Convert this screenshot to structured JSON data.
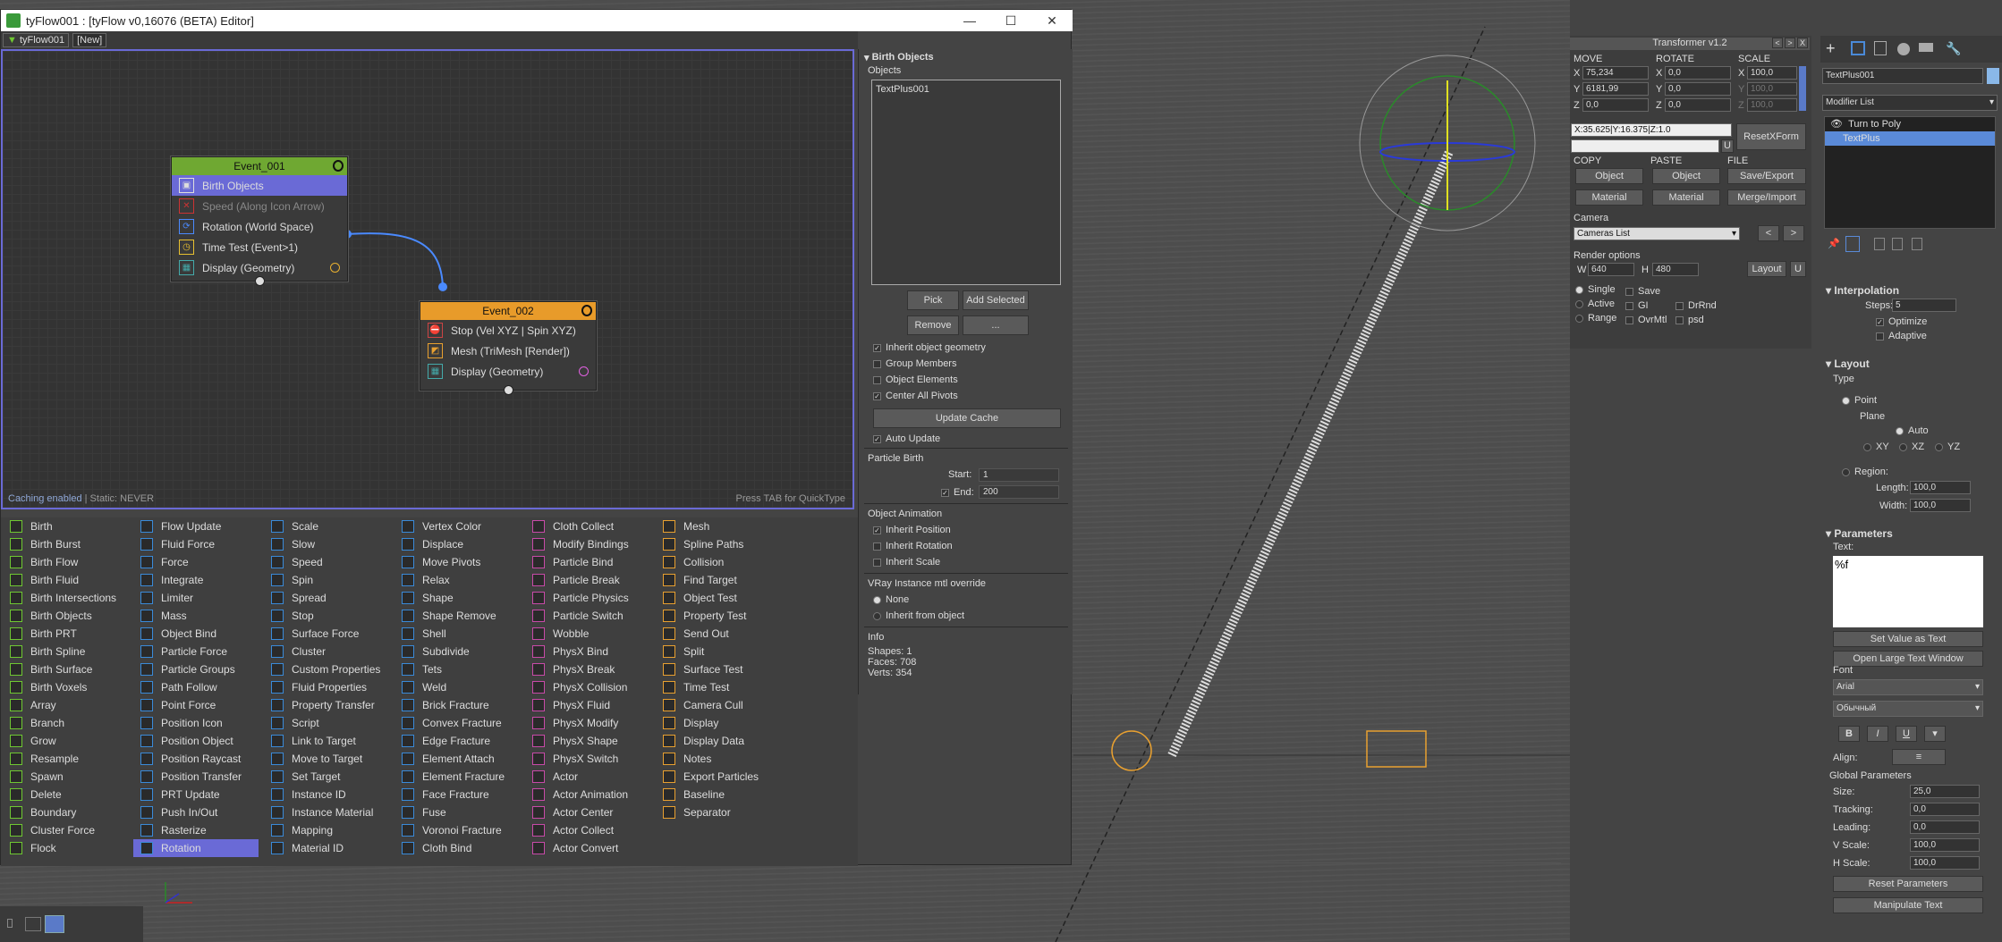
{
  "window": {
    "title": "tyFlow001 : [tyFlow v0,16076 (BETA) Editor]",
    "min": "—",
    "max": "☐",
    "close": "✕"
  },
  "tabs": [
    "tyFlow001",
    "[New]"
  ],
  "graph": {
    "status_enabled": "Caching enabled",
    "status_static": " | Static: NEVER",
    "hint": "Press TAB for QuickType",
    "event1": {
      "name": "Event_001",
      "color": "#6fa832",
      "ops": [
        "Birth Objects",
        "Speed (Along Icon Arrow)",
        "Rotation (World Space)",
        "Time Test (Event>1)",
        "Display (Geometry)"
      ]
    },
    "event2": {
      "name": "Event_002",
      "color": "#e89b2a",
      "ops": [
        "Stop (Vel XYZ | Spin XYZ)",
        "Mesh (TriMesh [Render])",
        "Display (Geometry)"
      ]
    }
  },
  "right_panel": {
    "title": "Birth Objects",
    "objects_label": "Objects",
    "object_item": "TextPlus001",
    "pick": "Pick",
    "add_selected": "Add Selected",
    "remove": "Remove",
    "more": "...",
    "inherit_geom": "Inherit object geometry",
    "group_members": "Group Members",
    "object_elements": "Object Elements",
    "center_pivots": "Center All Pivots",
    "update_cache": "Update Cache",
    "auto_update": "Auto Update",
    "particle_birth": "Particle Birth",
    "start_label": "Start:",
    "start_val": "1",
    "end_label": "End:",
    "end_val": "200",
    "object_animation": "Object Animation",
    "inherit_position": "Inherit Position",
    "inherit_rotation": "Inherit Rotation",
    "inherit_scale": "Inherit Scale",
    "vray_label": "VRay Instance mtl override",
    "vray_none": "None",
    "vray_inherit": "Inherit from object",
    "info_label": "Info",
    "shapes": "Shapes: 1",
    "faces": "Faces: 708",
    "verts": "Verts: 354"
  },
  "operators": [
    [
      "Birth",
      "Birth Burst",
      "Birth Flow",
      "Birth Fluid",
      "Birth Intersections",
      "Birth Objects",
      "Birth PRT",
      "Birth Spline",
      "Birth Surface",
      "Birth Voxels",
      "Array",
      "Branch",
      "Grow",
      "Resample",
      "Spawn",
      "Delete",
      "Boundary",
      "Cluster Force",
      "Flock"
    ],
    [
      "Flow Update",
      "Fluid Force",
      "Force",
      "Integrate",
      "Limiter",
      "Mass",
      "Object Bind",
      "Particle Force",
      "Particle Groups",
      "Path Follow",
      "Point Force",
      "Position Icon",
      "Position Object",
      "Position Raycast",
      "Position Transfer",
      "PRT Update",
      "Push In/Out",
      "Rasterize",
      "Rotation"
    ],
    [
      "Scale",
      "Slow",
      "Speed",
      "Spin",
      "Spread",
      "Stop",
      "Surface Force",
      "Cluster",
      "Custom Properties",
      "Fluid Properties",
      "Property Transfer",
      "Script",
      "Link to Target",
      "Move to Target",
      "Set Target",
      "Instance ID",
      "Instance Material",
      "Mapping",
      "Material ID"
    ],
    [
      "Vertex Color",
      "Displace",
      "Move Pivots",
      "Relax",
      "Shape",
      "Shape Remove",
      "Shell",
      "Subdivide",
      "Tets",
      "Weld",
      "Brick Fracture",
      "Convex Fracture",
      "Edge Fracture",
      "Element Attach",
      "Element Fracture",
      "Face Fracture",
      "Fuse",
      "Voronoi Fracture",
      "Cloth Bind"
    ],
    [
      "Cloth Collect",
      "Modify Bindings",
      "Particle Bind",
      "Particle Break",
      "Particle Physics",
      "Particle Switch",
      "Wobble",
      "PhysX Bind",
      "PhysX Break",
      "PhysX Collision",
      "PhysX Fluid",
      "PhysX Modify",
      "PhysX Shape",
      "PhysX Switch",
      "Actor",
      "Actor Animation",
      "Actor Center",
      "Actor Collect",
      "Actor Convert"
    ],
    [
      "Mesh",
      "Spline Paths",
      "Collision",
      "Find Target",
      "Object Test",
      "Property Test",
      "Send Out",
      "Split",
      "Surface Test",
      "Time Test",
      "Camera Cull",
      "Display",
      "Display Data",
      "Notes",
      "Export Particles",
      "Baseline",
      "Separator"
    ]
  ],
  "transformer": {
    "title": "Transformer v1.2",
    "nav_left": "<",
    "nav_right": ">",
    "close": "X",
    "move": "MOVE",
    "rotate": "ROTATE",
    "scale": "SCALE",
    "mx": "75,234",
    "my": "6181,99",
    "mz": "0,0",
    "rx": "0,0",
    "ry": "0,0",
    "rz": "0,0",
    "sx": "100,0",
    "sy": "100,0",
    "sz": "100,0",
    "coord": "X:35.625|Y:16.375|Z:1.0",
    "reset": "ResetXForm",
    "u": "U",
    "copy": "COPY",
    "paste": "PASTE",
    "file": "FILE",
    "object": "Object",
    "material": "Material",
    "save_export": "Save/Export",
    "merge_import": "Merge/Import",
    "camera": "Camera",
    "cameras_list": "Cameras List",
    "render_options": "Render options",
    "w_label": "W",
    "w": "640",
    "h_label": "H",
    "h": "480",
    "layout": "Layout",
    "single": "Single",
    "active": "Active",
    "range": "Range",
    "save": "Save",
    "gi": "GI",
    "drrnd": "DrRnd",
    "ovrmtl": "OvrMtl",
    "psd": "psd",
    "x": "X",
    "y": "Y",
    "z": "Z"
  },
  "modify": {
    "object_name": "TextPlus001",
    "modifier_list": "Modifier List",
    "stack": [
      "Turn to Poly",
      "TextPlus"
    ],
    "interpolation": "Interpolation",
    "steps_label": "Steps:",
    "steps": "5",
    "optimize": "Optimize",
    "adaptive": "Adaptive",
    "layout": "Layout",
    "type": "Type",
    "point": "Point",
    "plane": "Plane",
    "auto": "Auto",
    "xy": "XY",
    "xz": "XZ",
    "yz": "YZ",
    "region": "Region:",
    "length_label": "Length:",
    "length": "100,0",
    "width_label": "Width:",
    "width": "100,0",
    "parameters": "Parameters",
    "text_label": "Text:",
    "text_val": "%f",
    "set_value": "Set Value as Text",
    "open_large": "Open Large Text Window",
    "font": "Font",
    "font_name": "Arial",
    "font_style": "Обычный",
    "bold": "B",
    "italic": "I",
    "underline": "U",
    "align": "Align:",
    "global_params": "Global Parameters",
    "size_label": "Size:",
    "size": "25,0",
    "tracking_label": "Tracking:",
    "tracking": "0,0",
    "leading_label": "Leading:",
    "leading": "0,0",
    "vscale_label": "V Scale:",
    "vscale": "100,0",
    "hscale_label": "H Scale:",
    "hscale": "100,0",
    "reset_params": "Reset Parameters",
    "manipulate": "Manipulate Text"
  }
}
